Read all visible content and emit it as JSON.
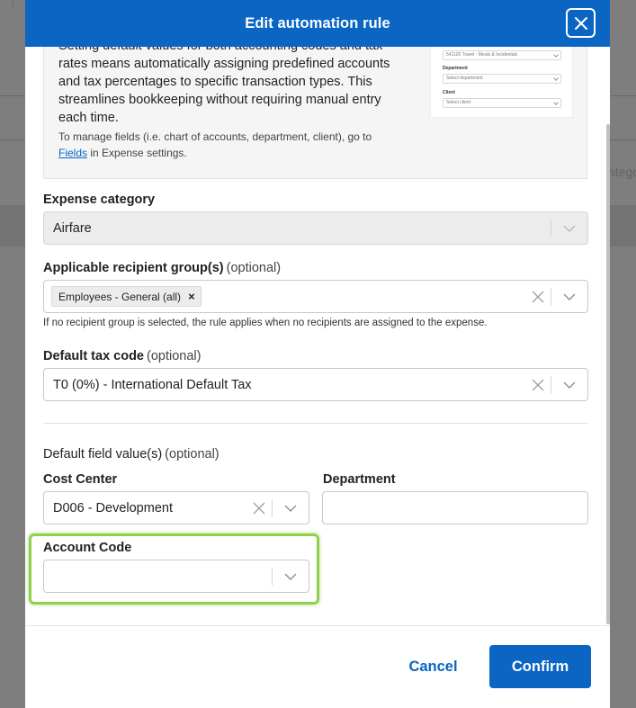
{
  "background": {
    "ghost_text": "atego"
  },
  "modal": {
    "title": "Edit automation rule"
  },
  "info": {
    "paragraph": "Setting default values for both accounting codes and tax rates means automatically assigning predefined accounts and tax percentages to specific transaction types. This streamlines bookkeeping without requiring manual entry each time.",
    "note_prefix": "To manage fields (i.e. chart of accounts, department, client), go to",
    "note_link": "Fields",
    "note_suffix": "in Expense settings.",
    "preview": {
      "top_field": "541120 Travel - Meals & Incidentals",
      "department_label": "Department",
      "department_placeholder": "Select department",
      "client_label": "Client",
      "client_placeholder": "Select client"
    }
  },
  "form": {
    "expense_category": {
      "label": "Expense category",
      "value": "Airfare"
    },
    "recipient_groups": {
      "label": "Applicable recipient group(s)",
      "optional": "(optional)",
      "chip": "Employees - General (all)",
      "hint": "If no recipient group is selected, the rule applies when no recipients are assigned to the expense."
    },
    "tax_code": {
      "label": "Default tax code",
      "optional": "(optional)",
      "value": "T0 (0%) - International Default Tax"
    },
    "default_fields": {
      "label": "Default field value(s)",
      "optional": "(optional)"
    },
    "cost_center": {
      "label": "Cost Center",
      "value": "D006 - Development"
    },
    "department": {
      "label": "Department",
      "value": ""
    },
    "account_code": {
      "label": "Account Code",
      "value": ""
    }
  },
  "footer": {
    "cancel": "Cancel",
    "confirm": "Confirm"
  },
  "colors": {
    "primary": "#0a66c2",
    "highlight": "#8fd14f"
  }
}
